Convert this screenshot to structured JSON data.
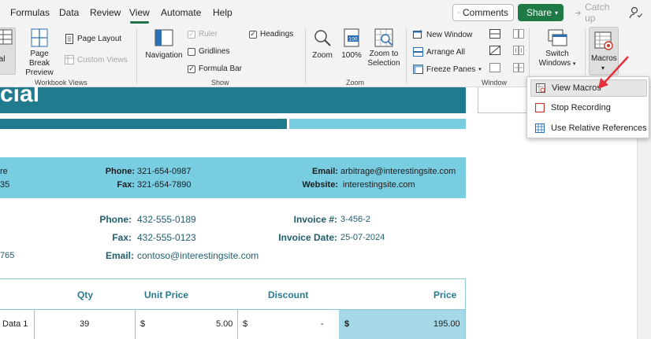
{
  "tabs": [
    "Formulas",
    "Data",
    "Review",
    "View",
    "Automate",
    "Help"
  ],
  "active_tab": "View",
  "header_buttons": {
    "comments": "Comments",
    "share": "Share",
    "catchup": "Catch up"
  },
  "ribbon": {
    "workbook_views": {
      "group": "Workbook Views",
      "normal": "rmal",
      "page_break_line1": "Page Break",
      "page_break_line2": "Preview",
      "page_layout": "Page Layout",
      "custom_views": "Custom Views"
    },
    "show": {
      "group": "Show",
      "ruler": "Ruler",
      "gridlines": "Gridlines",
      "formula_bar": "Formula Bar",
      "headings": "Headings",
      "navigation": "Navigation"
    },
    "zoom": {
      "group": "Zoom",
      "zoom": "Zoom",
      "hundred": "100%",
      "zoom_sel_line1": "Zoom to",
      "zoom_sel_line2": "Selection"
    },
    "window": {
      "group": "Window",
      "new_window": "New Window",
      "arrange_all": "Arrange All",
      "freeze_panes": "Freeze Panes",
      "switch_line1": "Switch",
      "switch_line2": "Windows"
    },
    "macros": {
      "label": "Macros"
    }
  },
  "macro_menu": [
    "View Macros",
    "Stop Recording",
    "Use Relative References"
  ],
  "sheet": {
    "title_fragment": "cial",
    "company": {
      "left_line1": "re",
      "left_line2": "35",
      "phone_label": "Phone:",
      "phone": "321-654-0987",
      "fax_label": "Fax:",
      "fax": "321-654-7890",
      "email_label": "Email:",
      "email": "arbitrage@interestingsite.com",
      "website_label": "Website:",
      "website": "interestingsite.com"
    },
    "client": {
      "phone_label": "Phone:",
      "phone": "432-555-0189",
      "fax_label": "Fax:",
      "fax": "432-555-0123",
      "email_label": "Email:",
      "email": "contoso@interestingsite.com",
      "left_fragment": "765",
      "invoice_label": "Invoice #:",
      "invoice": "3-456-2",
      "date_label": "Invoice Date:",
      "date": "25-07-2024"
    },
    "table": {
      "headers": [
        "Qty",
        "Unit Price",
        "Discount",
        "Price"
      ],
      "row1": {
        "item": "Data 1",
        "qty": "39",
        "unit_cur": "$",
        "unit": "5.00",
        "disc_cur": "$",
        "disc": "-",
        "price_cur": "$",
        "price": "195.00"
      }
    }
  },
  "colors": {
    "accent": "#217346",
    "band_dark": "#217b8e",
    "band_light": "#79cde0"
  }
}
